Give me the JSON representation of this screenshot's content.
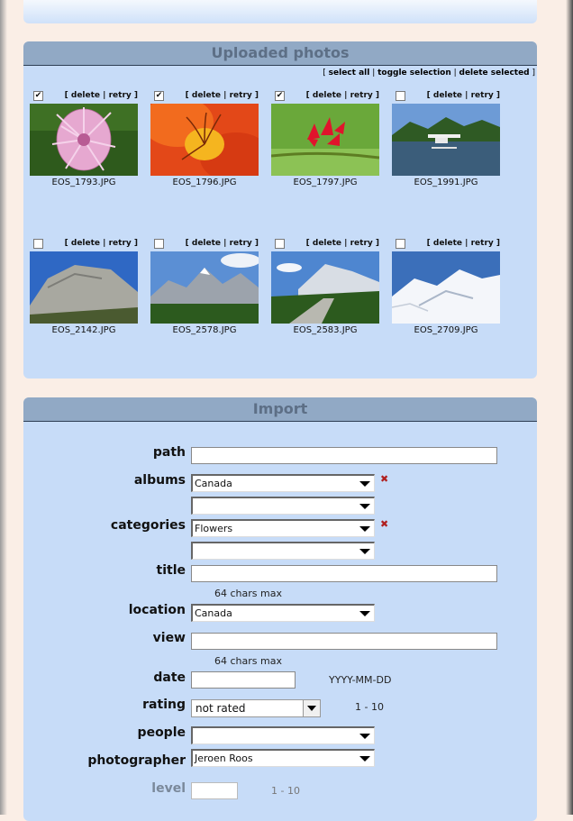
{
  "uploaded": {
    "title": "Uploaded photos",
    "select_all": "select all",
    "toggle_selection": "toggle selection",
    "delete_selected": "delete selected",
    "delete_label": "delete",
    "retry_label": "retry",
    "photos": [
      {
        "file": "EOS_1793.JPG",
        "checked": true
      },
      {
        "file": "EOS_1796.JPG",
        "checked": true
      },
      {
        "file": "EOS_1797.JPG",
        "checked": true
      },
      {
        "file": "EOS_1991.JPG",
        "checked": false
      },
      {
        "file": "EOS_2142.JPG",
        "checked": false
      },
      {
        "file": "EOS_2578.JPG",
        "checked": false
      },
      {
        "file": "EOS_2583.JPG",
        "checked": false
      },
      {
        "file": "EOS_2709.JPG",
        "checked": false
      }
    ]
  },
  "import": {
    "title": "Import",
    "path_label": "path",
    "albums_label": "albums",
    "albums_value": "Canada",
    "categories_label": "categories",
    "categories_value": "Flowers",
    "title_label": "title",
    "title_hint": "64 chars max",
    "location_label": "location",
    "location_value": "Canada",
    "view_label": "view",
    "view_hint": "64 chars max",
    "date_label": "date",
    "date_hint": "YYYY-MM-DD",
    "rating_label": "rating",
    "rating_value": "not rated",
    "rating_hint": "1 - 10",
    "people_label": "people",
    "photographer_label": "photographer",
    "photographer_value": "Jeroen Roos",
    "level_label": "level",
    "level_hint": "1 - 10"
  },
  "colors": {
    "panel_bg": "#c7dcf8",
    "title_bar": "#91a9c5",
    "required": "#b02020"
  }
}
